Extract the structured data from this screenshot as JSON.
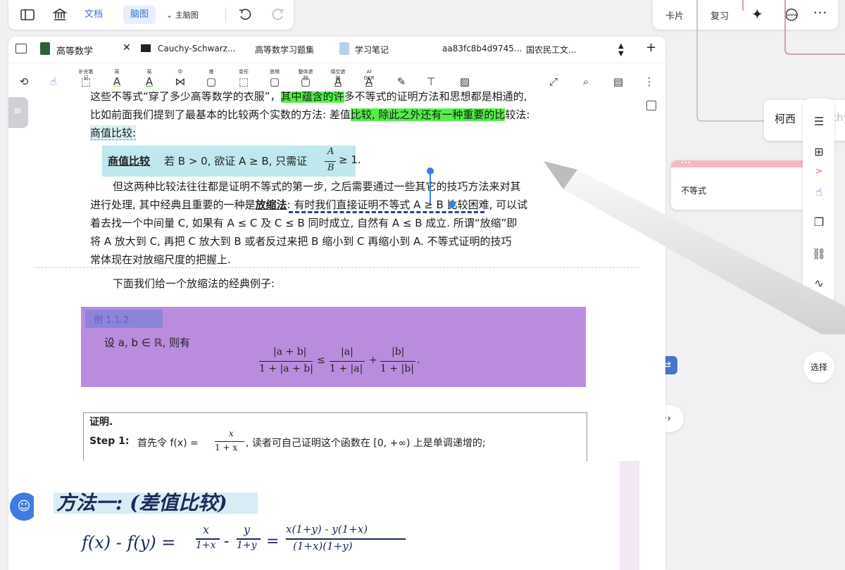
{
  "topbar": {
    "doc_label": "文档",
    "mindmap_label": "脑图",
    "mindmap_type": "主脑图"
  },
  "topright": {
    "cards": "卡片",
    "review": "复习"
  },
  "tabs": [
    {
      "label": "高等数学"
    },
    {
      "label": "Cauchy-Schwarz..."
    },
    {
      "label": "高等数学习题集"
    },
    {
      "label": "学习笔记"
    },
    {
      "label": "aa83fc8b4d9745..."
    },
    {
      "label": "国农民工文..."
    }
  ],
  "tools": [
    {
      "label": "补充笔记"
    },
    {
      "label": "易"
    },
    {
      "label": "易"
    },
    {
      "label": "中"
    },
    {
      "label": "难"
    },
    {
      "label": "变形"
    },
    {
      "label": "放缩"
    },
    {
      "label": "整体遮挡"
    },
    {
      "label": "填空遮挡"
    },
    {
      "label": "AI OCR"
    }
  ],
  "doc": {
    "l1a": "这些不等式“穿了多少高等数学的衣服”，",
    "l1b": "其中蕴含的许",
    "l1c": "多不等式的证明方法和思想都是相通的,",
    "l2a": "比如前面我们提到了最基本的比较两个实数的方法: 差值",
    "l2b": "比较, 除此之外还有一种重要的比",
    "l2c": "较法:",
    "l3": "商值比较:",
    "def_term": "商值比较",
    "def_text": "若 B > 0, 欲证 A ≥ B, 只需证",
    "def_frac_num": "A",
    "def_frac_den": "B",
    "def_end": "≥ 1.",
    "p1": "但这两种比较法往往都是证明不等式的第一步, 之后需要通过一些其它的技巧方法来对其",
    "p2a": "进行处理, 其中经典且重要的一种是",
    "p2b": "放缩法",
    "p2c": ": 有时我们直接证明不等式 A ≥ B 比较困难, 可以试",
    "p3": "着去找一个中间量 C, 如果有 A ≤ C 及 C ≤ B 同时成立, 自然有 A ≤ B 成立. 所谓“放缩”即",
    "p4": "将 A 放大到 C, 再把 C 放大到 B 或者反过来把 B 缩小到 C 再缩小到 A. 不等式证明的技巧",
    "p5": "常体现在对放缩尺度的把握上.",
    "p6": "下面我们给一个放缩法的经典例子:",
    "example_tag": "例 1.1.2.",
    "example_text": "设 a, b ∈ ℝ, 则有",
    "eq1_num": "|a + b|",
    "eq1_den": "1 + |a + b|",
    "eq_le": "≤",
    "eq2_num": "|a|",
    "eq2_den": "1 + |a|",
    "eq_plus": "+",
    "eq3_num": "|b|",
    "eq3_den": "1 + |b|",
    "eq_end": ".",
    "proof_title": "证明.",
    "step1_label": "Step 1:",
    "step1_a": "首先令 f(x) =",
    "step1_num": "x",
    "step1_den": "1 + x",
    "step1_b": ", 读者可自己证明这个函数在 [0, +∞) 上是单调递增的;"
  },
  "handwriting": {
    "title": "方法一: (差值比较)",
    "eq_left": "f(x) - f(y) =",
    "t1_num": "x",
    "t1_den": "1+x",
    "minus": "-",
    "t2_num": "y",
    "t2_den": "1+y",
    "equals": "=",
    "t3_num": "x(1+y) - y(1+x)",
    "t3_den": "(1+x)(1+y)"
  },
  "mindmap": {
    "node_cauchy": "柯西",
    "node_cauchy_faded": "(Cauchy",
    "node_ineq": "不等式",
    "select_label": "选择"
  }
}
